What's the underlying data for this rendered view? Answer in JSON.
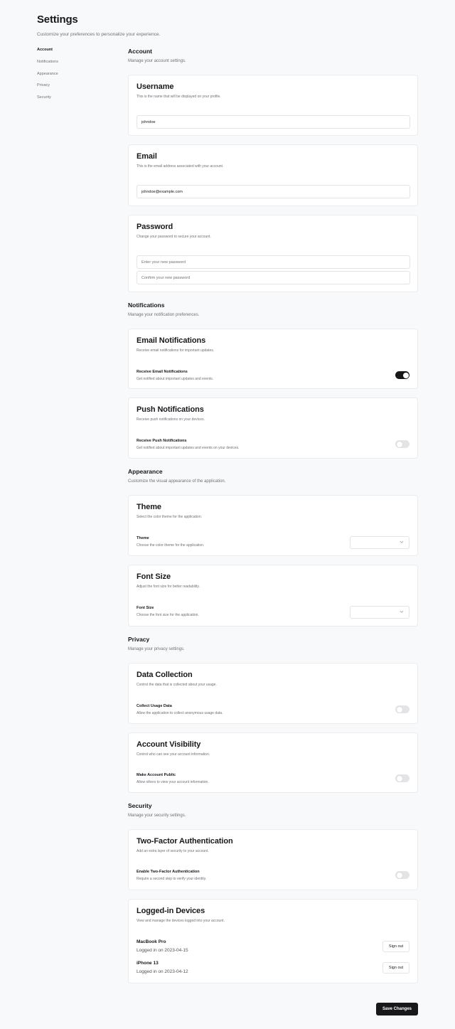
{
  "header": {
    "title": "Settings",
    "subtitle": "Customize your preferences to personalize your experience."
  },
  "sidebar": {
    "items": [
      {
        "label": "Account",
        "active": true
      },
      {
        "label": "Notifications",
        "active": false
      },
      {
        "label": "Appearance",
        "active": false
      },
      {
        "label": "Privacy",
        "active": false
      },
      {
        "label": "Security",
        "active": false
      }
    ]
  },
  "account": {
    "title": "Account",
    "desc": "Manage your account settings.",
    "username": {
      "title": "Username",
      "desc": "This is the name that will be displayed on your profile.",
      "value": "johndoe"
    },
    "email": {
      "title": "Email",
      "desc": "This is the email address associated with your account.",
      "value": "johndoe@example.com"
    },
    "password": {
      "title": "Password",
      "desc": "Change your password to secure your account.",
      "new_placeholder": "Enter your new password",
      "confirm_placeholder": "Confirm your new password"
    }
  },
  "notifications": {
    "title": "Notifications",
    "desc": "Manage your notification preferences.",
    "email": {
      "title": "Email Notifications",
      "desc": "Receive email notifications for important updates.",
      "row_label": "Receive Email Notifications",
      "row_desc": "Get notified about important updates and events.",
      "enabled": true
    },
    "push": {
      "title": "Push Notifications",
      "desc": "Receive push notifications on your devices.",
      "row_label": "Receive Push Notifications",
      "row_desc": "Get notified about important updates and events on your devices.",
      "enabled": false
    }
  },
  "appearance": {
    "title": "Appearance",
    "desc": "Customize the visual appearance of the application.",
    "theme": {
      "title": "Theme",
      "desc": "Select the color theme for the application.",
      "row_label": "Theme",
      "row_desc": "Choose the color theme for the application.",
      "selected": ""
    },
    "font_size": {
      "title": "Font Size",
      "desc": "Adjust the font size for better readability.",
      "row_label": "Font Size",
      "row_desc": "Choose the font size for the application.",
      "selected": ""
    }
  },
  "privacy": {
    "title": "Privacy",
    "desc": "Manage your privacy settings.",
    "data_collection": {
      "title": "Data Collection",
      "desc": "Control the data that is collected about your usage.",
      "row_label": "Collect Usage Data",
      "row_desc": "Allow the application to collect anonymous usage data.",
      "enabled": false
    },
    "visibility": {
      "title": "Account Visibility",
      "desc": "Control who can see your account information.",
      "row_label": "Make Account Public",
      "row_desc": "Allow others to view your account information.",
      "enabled": false
    }
  },
  "security": {
    "title": "Security",
    "desc": "Manage your security settings.",
    "two_factor": {
      "title": "Two-Factor Authentication",
      "desc": "Add an extra layer of security to your account.",
      "row_label": "Enable Two-Factor Authentication",
      "row_desc": "Require a second step to verify your identity.",
      "enabled": false
    },
    "devices": {
      "title": "Logged-in Devices",
      "desc": "View and manage the devices logged into your account.",
      "list": [
        {
          "name": "MacBook Pro",
          "date": "Logged in on 2023-04-15",
          "button": "Sign out"
        },
        {
          "name": "iPhone 13",
          "date": "Logged in on 2023-04-12",
          "button": "Sign out"
        }
      ]
    }
  },
  "footer": {
    "save_label": "Save Changes"
  },
  "icons": {
    "select_chevron": "chevron-down-icon"
  },
  "colors": {
    "background": "#f8f9fa",
    "accent": "#18181b",
    "muted": "#71717a"
  }
}
